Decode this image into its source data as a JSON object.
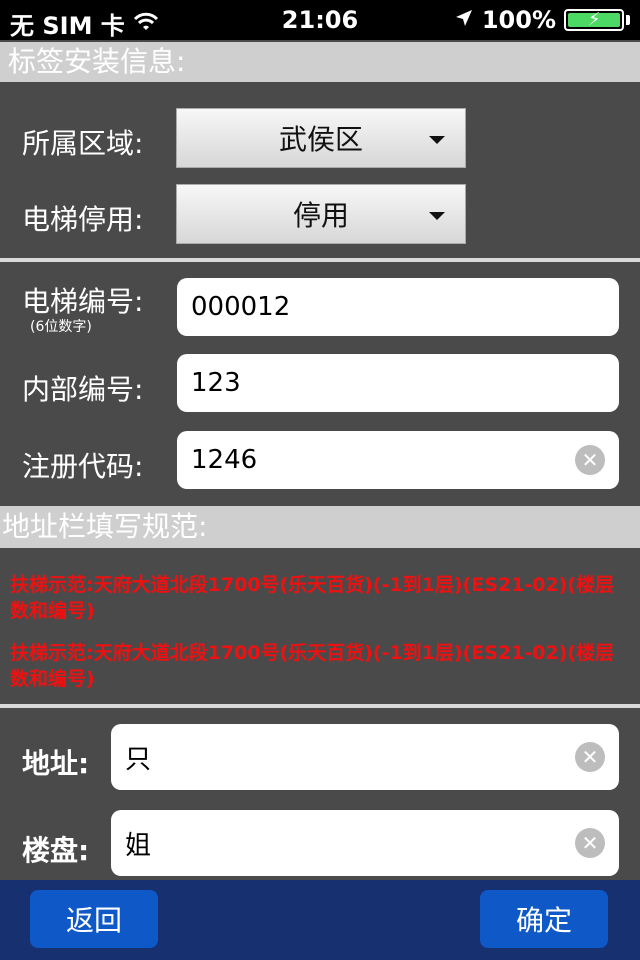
{
  "status_bar": {
    "carrier": "无 SIM 卡",
    "time": "21:06",
    "battery": "100%"
  },
  "section_tag_install": {
    "title": "标签安装信息:"
  },
  "region": {
    "label": "所属区域:",
    "value": "武侯区"
  },
  "elevator_status": {
    "label": "电梯停用:",
    "value": "停用"
  },
  "elevator_number": {
    "label": "电梯编号:",
    "hint": "(6位数字)",
    "value": "000012"
  },
  "internal_number": {
    "label": "内部编号:",
    "value": "123"
  },
  "register_code": {
    "label": "注册代码:",
    "value": "1246"
  },
  "section_address_rules": {
    "title": "地址栏填写规范:"
  },
  "examples": [
    "扶梯示范:天府大道北段1700号(乐天百货)(-1到1层)(ES21-02)(楼层数和编号)",
    "扶梯示范:天府大道北段1700号(乐天百货)(-1到1层)(ES21-02)(楼层数和编号)"
  ],
  "address": {
    "label": "地址:",
    "value": "只"
  },
  "property": {
    "label": "楼盘:",
    "value": "姐"
  },
  "bottom_bar": {
    "back_label": "返回",
    "confirm_label": "确定"
  },
  "colors": {
    "accent_blue": "#0e58c8",
    "bar_blue": "#163070",
    "warning_red": "#e11111"
  }
}
